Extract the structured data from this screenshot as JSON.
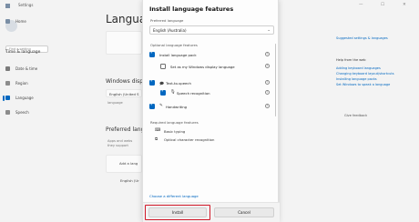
{
  "window": {
    "app_title": "Settings",
    "controls": [
      "—",
      "☐",
      "✕"
    ]
  },
  "sidebar": {
    "search_placeholder": "Find a setting",
    "section_label": "Time & language",
    "items": [
      {
        "label": "Home",
        "icon": "home-icon",
        "color": "#7a8ea5"
      },
      {
        "label": "Date & time",
        "icon": "clock-icon",
        "color": "#7a7a7a"
      },
      {
        "label": "Region",
        "icon": "globe-icon",
        "color": "#8c8c8c"
      },
      {
        "label": "Language",
        "icon": "language-icon",
        "color": "#0067c0"
      },
      {
        "label": "Speech",
        "icon": "microphone-icon",
        "color": "#8c8c8c"
      }
    ]
  },
  "background": {
    "page_title": "Language",
    "windows_display_heading": "Windows disp",
    "display_language_value": "English (United S",
    "display_language_desc": "language",
    "preferred_heading": "Preferred lang",
    "preferred_desc": "Apps and webs",
    "preferred_desc2": "they support",
    "add_language_label": "Add a lang",
    "english_us": "English (Ur"
  },
  "right_panel": {
    "links": [
      "Suggested settings & languages",
      "",
      "Help from the web",
      "Adding keyboard languages",
      "Changing keyboard layout/shortcuts",
      "Installing language packs",
      "Set Windows to speak a language"
    ],
    "feedback": "Give feedback"
  },
  "dialog": {
    "title": "Install language features",
    "preferred_label": "Preferred language",
    "preferred_value": "English (Australia)",
    "optional_heading": "Optional language features",
    "features": [
      {
        "label": "Install language pack",
        "checked": true,
        "indent": false,
        "icon": "language-pack-icon"
      },
      {
        "label": "Set as my Windows display language",
        "checked": false,
        "indent": true,
        "icon": "display-icon"
      },
      {
        "label": "Text-to-speech",
        "checked": true,
        "indent": false,
        "icon": "speech-icon"
      },
      {
        "label": "Speech recognition",
        "checked": true,
        "indent": true,
        "icon": "microphone-icon"
      },
      {
        "label": "Handwriting",
        "checked": true,
        "indent": false,
        "icon": "pen-icon"
      }
    ],
    "required_heading": "Required language features",
    "required": [
      {
        "label": "Basic typing",
        "icon": "keyboard-icon"
      },
      {
        "label": "Optical character recognition",
        "icon": "ocr-icon"
      }
    ],
    "choose_link": "Choose a different language",
    "install_label": "Install",
    "cancel_label": "Cancel"
  },
  "colors": {
    "accent": "#0067c0",
    "highlight_outline": "#d11a2a"
  }
}
